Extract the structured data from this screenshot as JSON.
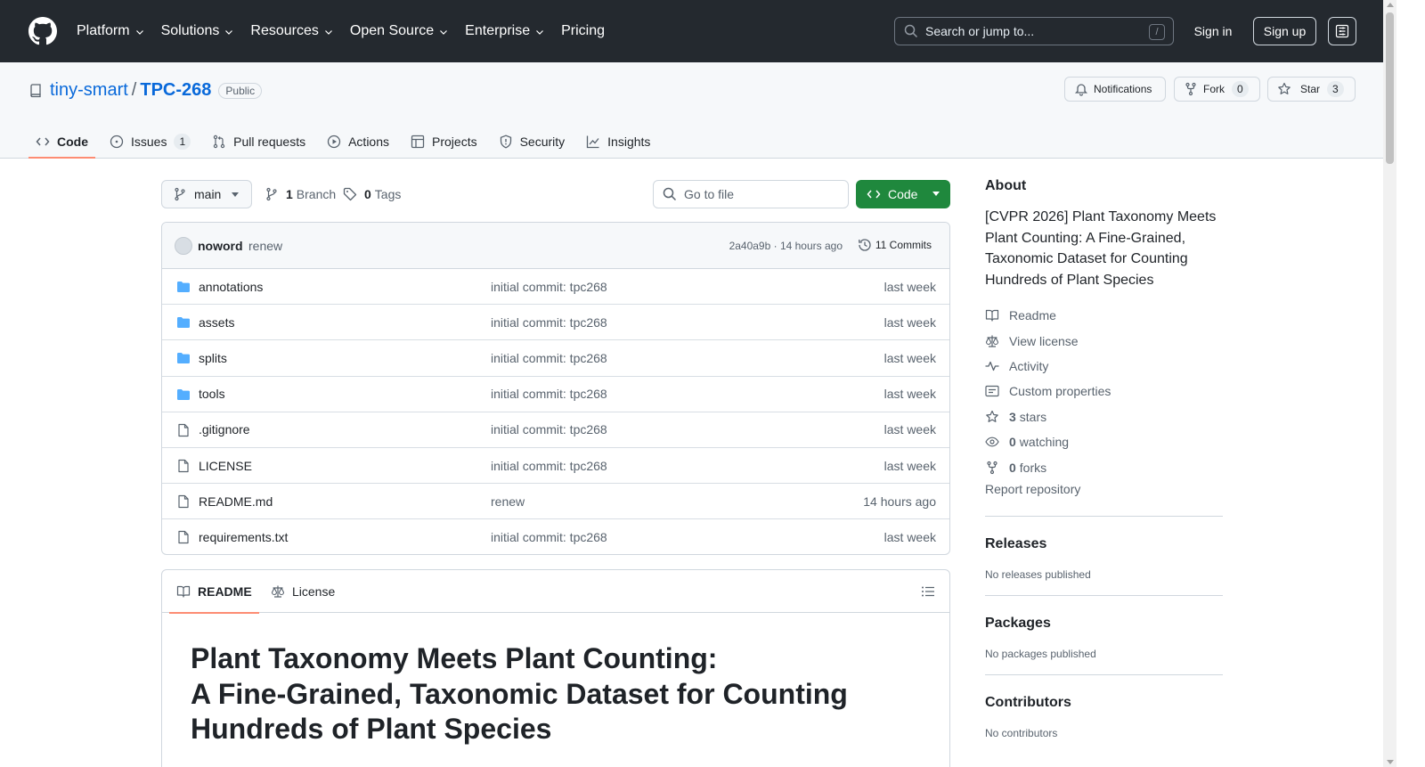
{
  "colors": {
    "header_bg": "#24292f",
    "link": "#0969da",
    "primary_button": "#1f883d",
    "active_tab_underline": "#fd8c73",
    "folder": "#54aeff"
  },
  "header": {
    "nav": [
      {
        "label": "Platform",
        "has_dropdown": true
      },
      {
        "label": "Solutions",
        "has_dropdown": true
      },
      {
        "label": "Resources",
        "has_dropdown": true
      },
      {
        "label": "Open Source",
        "has_dropdown": true
      },
      {
        "label": "Enterprise",
        "has_dropdown": true
      },
      {
        "label": "Pricing",
        "has_dropdown": false
      }
    ],
    "search_placeholder": "Search or jump to...",
    "search_shortcut": "/",
    "signin": "Sign in",
    "signup": "Sign up"
  },
  "repo": {
    "owner": "tiny-smart",
    "separator": "/",
    "name": "TPC-268",
    "visibility": "Public",
    "notifications_label": "Notifications",
    "fork_label": "Fork",
    "fork_count": "0",
    "star_label": "Star",
    "star_count": "3"
  },
  "tabs": [
    {
      "label": "Code",
      "icon": "code-icon",
      "active": true
    },
    {
      "label": "Issues",
      "icon": "issue-icon",
      "count": "1"
    },
    {
      "label": "Pull requests",
      "icon": "pull-request-icon"
    },
    {
      "label": "Actions",
      "icon": "play-icon"
    },
    {
      "label": "Projects",
      "icon": "table-icon"
    },
    {
      "label": "Security",
      "icon": "shield-icon"
    },
    {
      "label": "Insights",
      "icon": "graph-icon"
    }
  ],
  "branchbar": {
    "branch": "main",
    "branches_count": "1",
    "branches_label": "Branch",
    "tags_count": "0",
    "tags_label": "Tags",
    "goto_placeholder": "Go to file",
    "code_button": "Code"
  },
  "latest_commit": {
    "author": "noword",
    "message": "renew",
    "hash_time": "2a40a9b · 14 hours ago",
    "commits_label": "11 Commits"
  },
  "files": [
    {
      "name": "annotations",
      "type": "folder",
      "message": "initial commit: tpc268",
      "time": "last week"
    },
    {
      "name": "assets",
      "type": "folder",
      "message": "initial commit: tpc268",
      "time": "last week"
    },
    {
      "name": "splits",
      "type": "folder",
      "message": "initial commit: tpc268",
      "time": "last week"
    },
    {
      "name": "tools",
      "type": "folder",
      "message": "initial commit: tpc268",
      "time": "last week"
    },
    {
      "name": ".gitignore",
      "type": "file",
      "message": "initial commit: tpc268",
      "time": "last week"
    },
    {
      "name": "LICENSE",
      "type": "file",
      "message": "initial commit: tpc268",
      "time": "last week"
    },
    {
      "name": "README.md",
      "type": "file",
      "message": "renew",
      "time": "14 hours ago"
    },
    {
      "name": "requirements.txt",
      "type": "file",
      "message": "initial commit: tpc268",
      "time": "last week"
    }
  ],
  "readme": {
    "tab_readme": "README",
    "tab_license": "License",
    "heading_lines": [
      "Plant Taxonomy Meets Plant Counting:",
      "A Fine-Grained, Taxonomic Dataset for Counting",
      "Hundreds of Plant Species"
    ]
  },
  "sidebar": {
    "about_title": "About",
    "about_text": "[CVPR 2026] Plant Taxonomy Meets Plant Counting: A Fine-Grained, Taxonomic Dataset for Counting Hundreds of Plant Species",
    "links": [
      {
        "label": "Readme",
        "icon": "book-icon"
      },
      {
        "label": "View license",
        "icon": "law-icon"
      },
      {
        "label": "Activity",
        "icon": "pulse-icon"
      },
      {
        "label": "Custom properties",
        "icon": "note-icon"
      },
      {
        "count": "3",
        "label": "stars",
        "icon": "star-icon"
      },
      {
        "count": "0",
        "label": "watching",
        "icon": "eye-icon"
      },
      {
        "count": "0",
        "label": "forks",
        "icon": "fork-icon"
      }
    ],
    "report": "Report repository",
    "releases_title": "Releases",
    "releases_empty": "No releases published",
    "packages_title": "Packages",
    "packages_empty": "No packages published",
    "contributors_title": "Contributors",
    "contributors_empty": "No contributors"
  }
}
